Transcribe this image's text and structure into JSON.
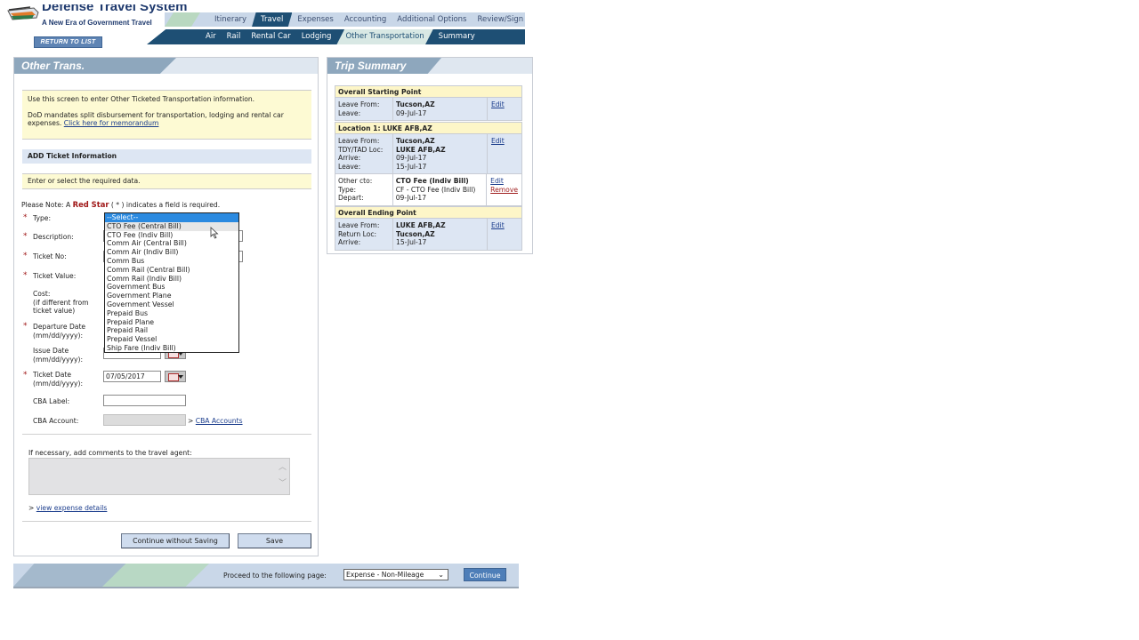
{
  "header": {
    "app_title": "Defense Travel System",
    "app_subtitle": "A New Era of Government Travel",
    "return_button": "RETURN TO LIST"
  },
  "nav_primary": [
    {
      "label": "Itinerary",
      "active": false
    },
    {
      "label": "Travel",
      "active": true
    },
    {
      "label": "Expenses",
      "active": false
    },
    {
      "label": "Accounting",
      "active": false
    },
    {
      "label": "Additional Options",
      "active": false
    },
    {
      "label": "Review/Sign",
      "active": false
    }
  ],
  "nav_secondary": [
    {
      "label": "Air",
      "active": false
    },
    {
      "label": "Rail",
      "active": false
    },
    {
      "label": "Rental Car",
      "active": false
    },
    {
      "label": "Lodging",
      "active": false
    },
    {
      "label": "Other Transportation",
      "active": true
    },
    {
      "label": "Summary",
      "active": false
    }
  ],
  "left_panel": {
    "title": "Other Trans.",
    "info_line1": "Use this screen to enter Other Ticketed Transportation information.",
    "info_line2": "DoD mandates split disbursement for transportation, lodging and rental car expenses.",
    "memo_link": "Click here for memorandum",
    "section_title": "ADD Ticket Information",
    "required_prompt": "Enter or select the required data.",
    "note_prefix": "Please Note:  A ",
    "note_red": "Red Star",
    "note_suffix": " ( * ) indicates a field is required.",
    "required_star": "*",
    "fields": {
      "type": "Type:",
      "description": "Description:",
      "ticket_no": "Ticket No:",
      "ticket_value": "Ticket Value:",
      "cost_l1": "Cost:",
      "cost_l2": "(if different from",
      "cost_l3": "ticket value)",
      "departure_l1": "Departure Date",
      "departure_l2": "(mm/dd/yyyy):",
      "issue_l1": "Issue Date",
      "issue_l2": "(mm/dd/yyyy):",
      "ticket_date_l1": "Ticket Date",
      "ticket_date_l2": "(mm/dd/yyyy):",
      "ticket_date_value": "07/05/2017",
      "cba_label": "CBA Label:",
      "cba_account": "CBA Account:",
      "cba_link": "CBA Accounts",
      "cba_arrow": ">"
    },
    "type_options": [
      "--Select--",
      "CTO Fee (Central Bill)",
      "CTO Fee (Indiv Bill)",
      "Comm Air (Central Bill)",
      "Comm Air (Indiv Bill)",
      "Comm Bus",
      "Comm Rail (Central Bill)",
      "Comm Rail (Indiv Bill)",
      "Government Bus",
      "Government Plane",
      "Government Vessel",
      "Prepaid Bus",
      "Prepaid Plane",
      "Prepaid Rail",
      "Prepaid Vessel",
      "Ship Fare (Indiv Bill)"
    ],
    "type_selected_index": 0,
    "type_hover_index": 1,
    "comments_label": "If necessary, add comments to the travel agent:",
    "expense_link_arrow": ">",
    "expense_link": "view expense details",
    "continue_without_saving": "Continue without Saving",
    "save": "Save"
  },
  "trip_summary": {
    "title": "Trip Summary",
    "starting": {
      "header": "Overall Starting Point",
      "labels": [
        "Leave From:",
        "Leave:"
      ],
      "values": [
        "Tucson,AZ",
        "09-Jul-17"
      ],
      "edit": "Edit"
    },
    "location1": {
      "header": "Location 1:  LUKE AFB,AZ",
      "labels": [
        "Leave From:",
        "TDY/TAD Loc:",
        "Arrive:",
        "Leave:"
      ],
      "values": [
        "Tucson,AZ",
        "LUKE AFB,AZ",
        "09-Jul-17",
        "15-Jul-17"
      ],
      "edit": "Edit"
    },
    "other": {
      "labels": [
        "Other cto:",
        "Type:",
        "Depart:"
      ],
      "values": [
        "CTO Fee (Indiv Bill)",
        "CF - CTO Fee (Indiv Bill)",
        "09-Jul-17"
      ],
      "edit": "Edit",
      "remove": "Remove"
    },
    "ending": {
      "header": "Overall Ending Point",
      "labels": [
        "Leave From:",
        "Return Loc:",
        "Arrive:"
      ],
      "values": [
        "LUKE AFB,AZ",
        "Tucson,AZ",
        "15-Jul-17"
      ],
      "edit": "Edit"
    }
  },
  "footer": {
    "proceed_label": "Proceed to the following page:",
    "proceed_value": "Expense - Non-Mileage",
    "continue": "Continue"
  },
  "colors": {
    "nav_dark": "#1e4f74",
    "required_red": "#a01818",
    "info_yellow": "#fdfad3",
    "section_blue": "#dde6f3",
    "select_highlight": "#2b8ae0"
  }
}
